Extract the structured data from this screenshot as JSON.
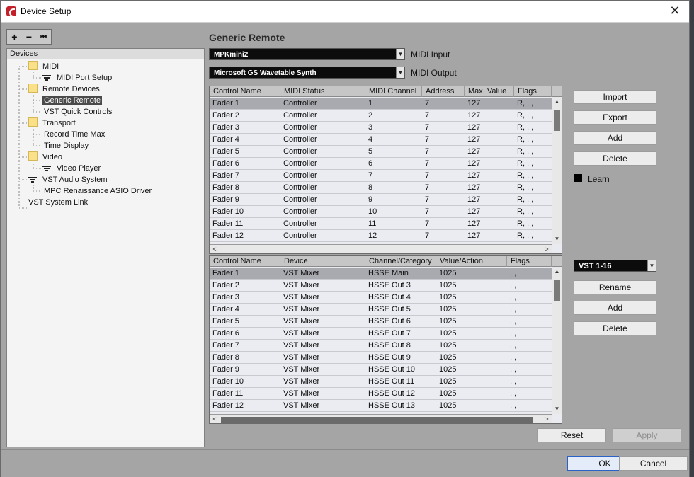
{
  "window": {
    "title": "Device Setup",
    "close_glyph": "✕"
  },
  "toolbar": {
    "add_glyph": "+",
    "remove_glyph": "−",
    "reset_glyph": "⏮"
  },
  "devices": {
    "header": "Devices",
    "items": [
      {
        "label": "MIDI",
        "level": 1,
        "icon": "folder-icon"
      },
      {
        "label": "MIDI Port Setup",
        "level": 2,
        "icon": "midi-port-icon"
      },
      {
        "label": "Remote Devices",
        "level": 1,
        "icon": "folder-icon"
      },
      {
        "label": "Generic Remote",
        "level": 2,
        "icon": "",
        "selected": true
      },
      {
        "label": "VST Quick Controls",
        "level": 2,
        "icon": ""
      },
      {
        "label": "Transport",
        "level": 1,
        "icon": "folder-icon"
      },
      {
        "label": "Record Time Max",
        "level": 2,
        "icon": ""
      },
      {
        "label": "Time Display",
        "level": 2,
        "icon": ""
      },
      {
        "label": "Video",
        "level": 1,
        "icon": "folder-icon"
      },
      {
        "label": "Video Player",
        "level": 2,
        "icon": "video-player-icon"
      },
      {
        "label": "VST Audio System",
        "level": 1,
        "icon": "audio-system-icon"
      },
      {
        "label": "MPC Renaissance ASIO Driver",
        "level": 2,
        "icon": ""
      },
      {
        "label": "VST System Link",
        "level": 0,
        "icon": ""
      }
    ]
  },
  "main": {
    "title": "Generic Remote",
    "midi_input": {
      "value": "MPKmini2",
      "label": "MIDI Input"
    },
    "midi_output": {
      "value": "Microsoft GS Wavetable Synth",
      "label": "MIDI Output"
    },
    "upper_table": {
      "headers": [
        "Control Name",
        "MIDI Status",
        "MIDI Channel",
        "Address",
        "Max. Value",
        "Flags"
      ],
      "rows": [
        [
          "Fader 1",
          "Controller",
          "1",
          "7",
          "127",
          "R, , ,"
        ],
        [
          "Fader 2",
          "Controller",
          "2",
          "7",
          "127",
          "R, , ,"
        ],
        [
          "Fader 3",
          "Controller",
          "3",
          "7",
          "127",
          "R, , ,"
        ],
        [
          "Fader 4",
          "Controller",
          "4",
          "7",
          "127",
          "R, , ,"
        ],
        [
          "Fader 5",
          "Controller",
          "5",
          "7",
          "127",
          "R, , ,"
        ],
        [
          "Fader 6",
          "Controller",
          "6",
          "7",
          "127",
          "R, , ,"
        ],
        [
          "Fader 7",
          "Controller",
          "7",
          "7",
          "127",
          "R, , ,"
        ],
        [
          "Fader 8",
          "Controller",
          "8",
          "7",
          "127",
          "R, , ,"
        ],
        [
          "Fader 9",
          "Controller",
          "9",
          "7",
          "127",
          "R, , ,"
        ],
        [
          "Fader 10",
          "Controller",
          "10",
          "7",
          "127",
          "R, , ,"
        ],
        [
          "Fader 11",
          "Controller",
          "11",
          "7",
          "127",
          "R, , ,"
        ],
        [
          "Fader 12",
          "Controller",
          "12",
          "7",
          "127",
          "R, , ,"
        ]
      ]
    },
    "upper_buttons": {
      "import": "Import",
      "export": "Export",
      "add": "Add",
      "delete": "Delete",
      "learn": "Learn"
    },
    "bank": {
      "value": "VST 1-16"
    },
    "lower_buttons": {
      "rename": "Rename",
      "add": "Add",
      "delete": "Delete"
    },
    "lower_table": {
      "headers": [
        "Control Name",
        "Device",
        "Channel/Category",
        "Value/Action",
        "Flags"
      ],
      "rows": [
        [
          "Fader 1",
          "VST Mixer",
          "HSSE Main",
          "1025",
          ", ,"
        ],
        [
          "Fader 2",
          "VST Mixer",
          "HSSE Out 3",
          "1025",
          ", ,"
        ],
        [
          "Fader 3",
          "VST Mixer",
          "HSSE Out 4",
          "1025",
          ", ,"
        ],
        [
          "Fader 4",
          "VST Mixer",
          "HSSE Out 5",
          "1025",
          ", ,"
        ],
        [
          "Fader 5",
          "VST Mixer",
          "HSSE Out 6",
          "1025",
          ", ,"
        ],
        [
          "Fader 6",
          "VST Mixer",
          "HSSE Out 7",
          "1025",
          ", ,"
        ],
        [
          "Fader 7",
          "VST Mixer",
          "HSSE Out 8",
          "1025",
          ", ,"
        ],
        [
          "Fader 8",
          "VST Mixer",
          "HSSE Out 9",
          "1025",
          ", ,"
        ],
        [
          "Fader 9",
          "VST Mixer",
          "HSSE Out 10",
          "1025",
          ", ,"
        ],
        [
          "Fader 10",
          "VST Mixer",
          "HSSE Out 11",
          "1025",
          ", ,"
        ],
        [
          "Fader 11",
          "VST Mixer",
          "HSSE Out 12",
          "1025",
          ", ,"
        ],
        [
          "Fader 12",
          "VST Mixer",
          "HSSE Out 13",
          "1025",
          ", ,"
        ]
      ]
    },
    "reset": "Reset",
    "apply": "Apply"
  },
  "footer": {
    "ok": "OK",
    "cancel": "Cancel"
  }
}
